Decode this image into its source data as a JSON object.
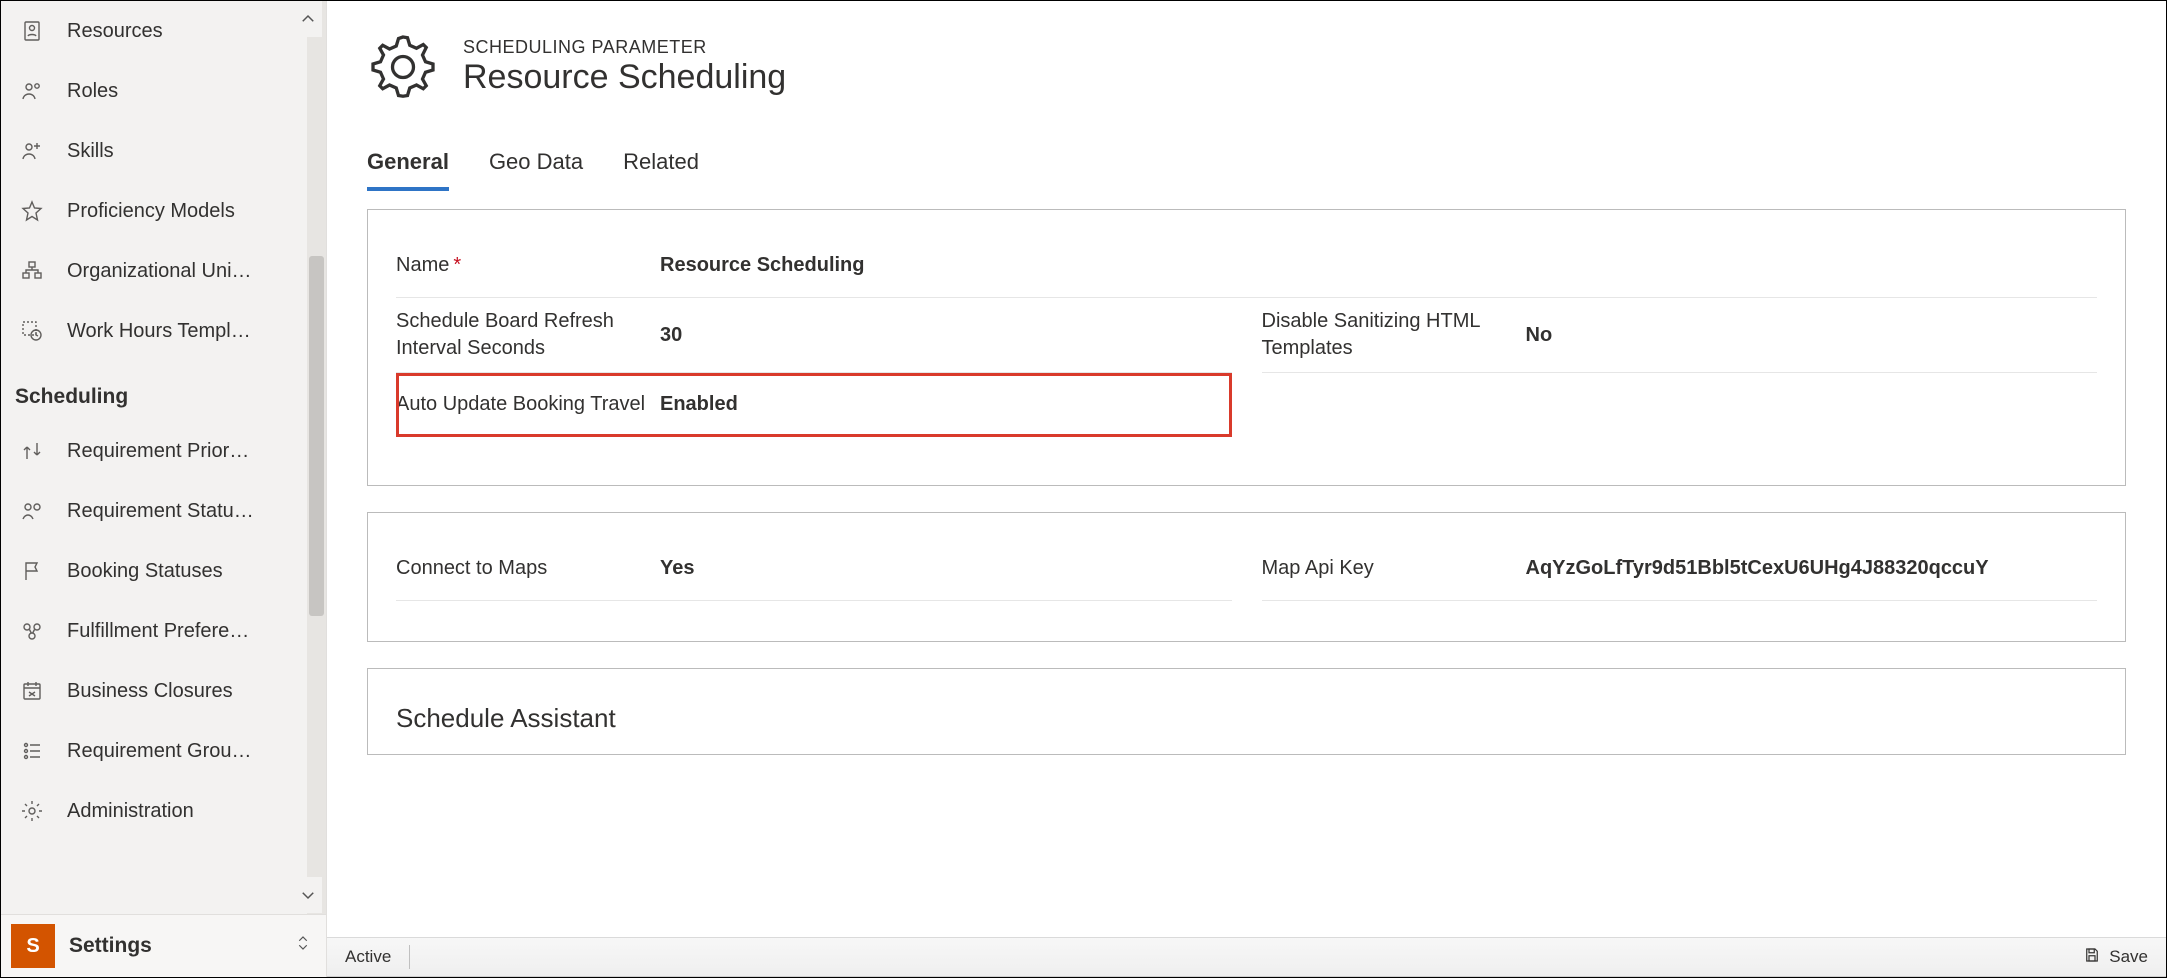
{
  "sidebar": {
    "items": [
      {
        "label": "Resources",
        "icon": "resources"
      },
      {
        "label": "Roles",
        "icon": "roles"
      },
      {
        "label": "Skills",
        "icon": "skills"
      },
      {
        "label": "Proficiency Models",
        "icon": "star"
      },
      {
        "label": "Organizational Uni…",
        "icon": "org"
      },
      {
        "label": "Work Hours Templ…",
        "icon": "clock"
      }
    ],
    "group_header": "Scheduling",
    "items2": [
      {
        "label": "Requirement Prior…",
        "icon": "priority"
      },
      {
        "label": "Requirement Statu…",
        "icon": "reqstatus"
      },
      {
        "label": "Booking Statuses",
        "icon": "flag"
      },
      {
        "label": "Fulfillment Prefere…",
        "icon": "fulfill"
      },
      {
        "label": "Business Closures",
        "icon": "calendar"
      },
      {
        "label": "Requirement Grou…",
        "icon": "list"
      },
      {
        "label": "Administration",
        "icon": "gear"
      }
    ],
    "area": {
      "badge": "S",
      "label": "Settings"
    }
  },
  "header": {
    "eyebrow": "SCHEDULING PARAMETER",
    "title": "Resource Scheduling"
  },
  "tabs": [
    {
      "label": "General",
      "active": true
    },
    {
      "label": "Geo Data",
      "active": false
    },
    {
      "label": "Related",
      "active": false
    }
  ],
  "form": {
    "name": {
      "label": "Name",
      "required": true,
      "value": "Resource Scheduling"
    },
    "refresh": {
      "label": "Schedule Board Refresh Interval Seconds",
      "value": "30"
    },
    "sanitize": {
      "label": "Disable Sanitizing HTML Templates",
      "value": "No"
    },
    "auto_travel": {
      "label": "Auto Update Booking Travel",
      "value": "Enabled"
    },
    "connect_maps": {
      "label": "Connect to Maps",
      "value": "Yes"
    },
    "map_api_key": {
      "label": "Map Api Key",
      "value": "AqYzGoLfTyr9d51Bbl5tCexU6UHg4J88320qccuY"
    },
    "schedule_assistant_title": "Schedule Assistant"
  },
  "status": {
    "state": "Active",
    "save": "Save"
  }
}
